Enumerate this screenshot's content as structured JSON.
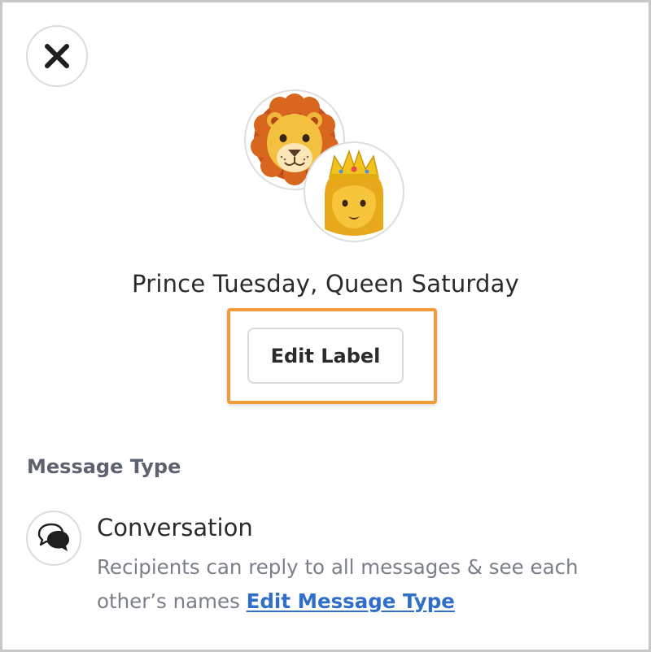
{
  "group": {
    "name": "Prince Tuesday, Queen Saturday",
    "avatars": [
      {
        "icon": "lion-face-icon"
      },
      {
        "icon": "princess-crown-icon"
      }
    ]
  },
  "actions": {
    "close_icon": "close-icon",
    "edit_label": "Edit Label"
  },
  "colors": {
    "highlight": "#f39b38",
    "link": "#2f6fc9"
  },
  "message_type": {
    "section_title": "Message Type",
    "icon": "speech-bubbles-icon",
    "name": "Conversation",
    "description": "Recipients can reply to all messages & see each other’s names",
    "edit_link": "Edit Message Type"
  }
}
